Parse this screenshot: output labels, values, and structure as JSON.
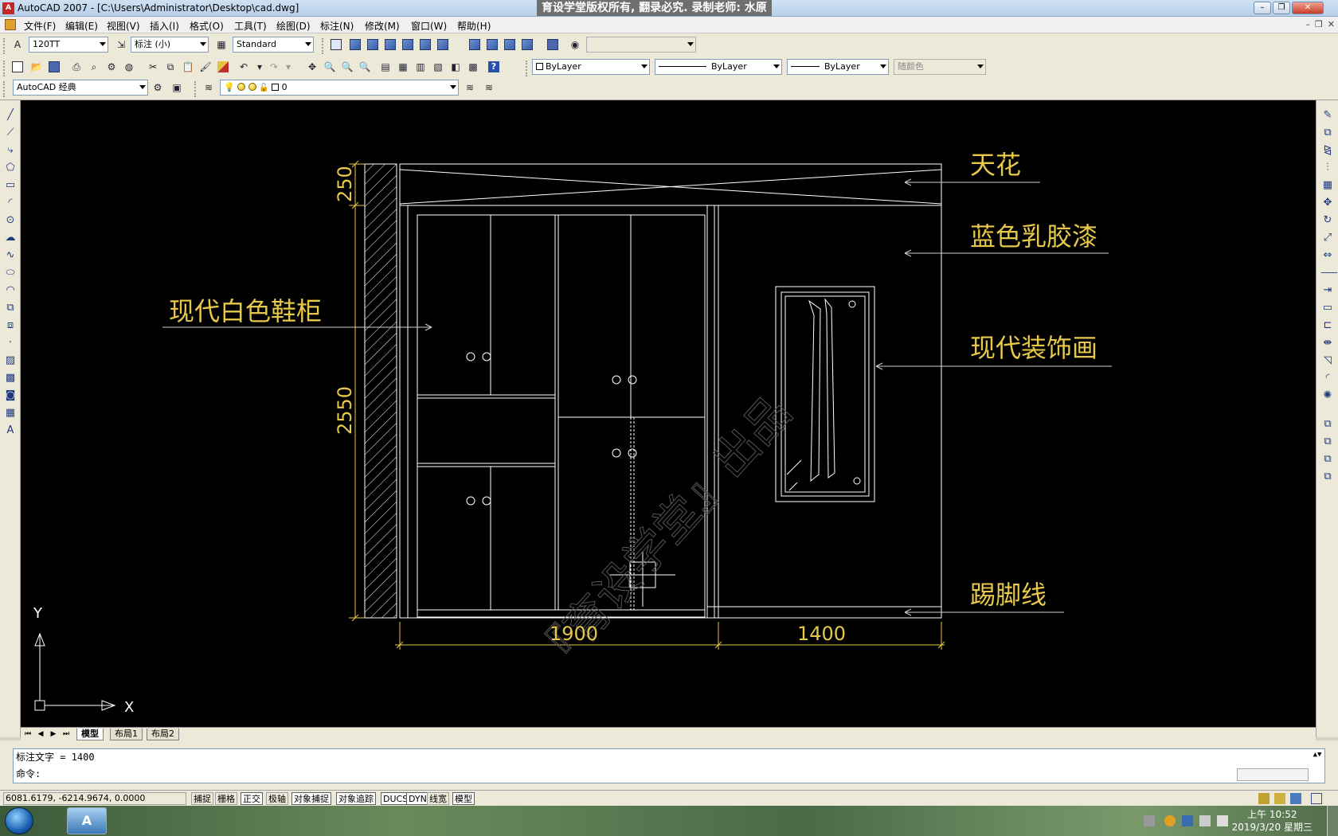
{
  "window": {
    "title": "AutoCAD 2007 - [C:\\Users\\Administrator\\Desktop\\cad.dwg]",
    "banner": "育设学堂版权所有, 翻录必究. 录制老师: 水原"
  },
  "menu": {
    "items": [
      "文件(F)",
      "编辑(E)",
      "视图(V)",
      "插入(I)",
      "格式(O)",
      "工具(T)",
      "绘图(D)",
      "标注(N)",
      "修改(M)",
      "窗口(W)",
      "帮助(H)"
    ]
  },
  "toolbars": {
    "text_style": "120TT",
    "dim_style": "标注 (小)",
    "table_style": "Standard",
    "workspace": "AutoCAD 经典",
    "layer": "0",
    "color": "ByLayer",
    "linetype": "ByLayer",
    "lineweight": "ByLayer",
    "plotstyle": "随颜色"
  },
  "drawing": {
    "labels": {
      "ceiling": "天花",
      "paint": "蓝色乳胶漆",
      "cabinet": "现代白色鞋柜",
      "painting": "现代装饰画",
      "baseboard": "踢脚线"
    },
    "dimensions": {
      "top_height": "250",
      "main_height": "2550",
      "width_left": "1900",
      "width_right": "1400"
    },
    "watermark": "『育设学堂』出品",
    "ucs": {
      "x_label": "X",
      "y_label": "Y"
    },
    "colors": {
      "background": "#000000",
      "lines": "#ffffff",
      "labels": "#e6c84a",
      "dims": "#e6c84a",
      "leaders": "#cfcfcf"
    }
  },
  "tabs": [
    "模型",
    "布局1",
    "布局2"
  ],
  "command": {
    "history": "标注文字 = 1400",
    "prompt": "命令:"
  },
  "status": {
    "coords": "6081.6179, -6214.9674, 0.0000",
    "toggles": [
      {
        "label": "捕捉",
        "on": false
      },
      {
        "label": "栅格",
        "on": false
      },
      {
        "label": "正交",
        "on": true
      },
      {
        "label": "极轴",
        "on": false
      },
      {
        "label": "对象捕捉",
        "on": true
      },
      {
        "label": "对象追踪",
        "on": true
      },
      {
        "label": "DUCS",
        "on": true
      },
      {
        "label": "DYN",
        "on": true
      },
      {
        "label": "线宽",
        "on": false
      },
      {
        "label": "模型",
        "on": true
      }
    ]
  },
  "taskbar": {
    "app": "A",
    "time": "上午 10:52",
    "date": "2019/3/20 星期三"
  }
}
